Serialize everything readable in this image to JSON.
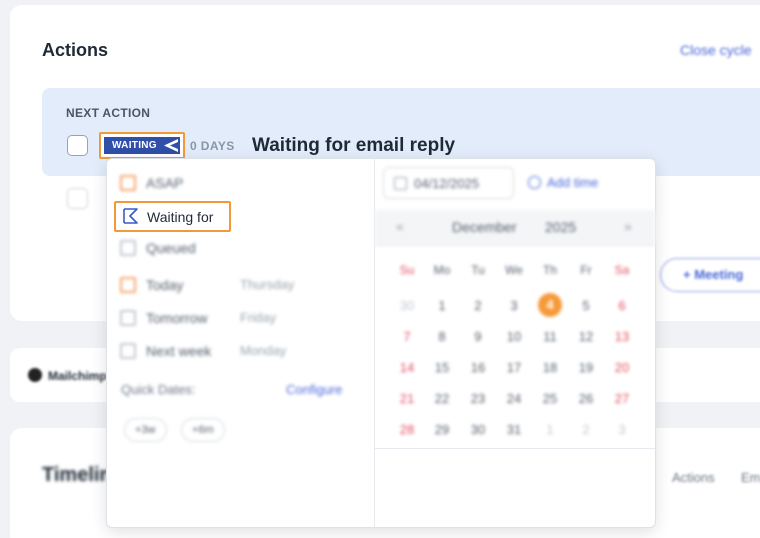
{
  "actions_section": {
    "title": "Actions",
    "close_cycle_label": "Close cycle",
    "next_action_label": "NEXT ACTION",
    "status_tag": "WAITING",
    "days_label": "0 DAYS",
    "action_title": "Waiting for email reply",
    "meeting_button_label": "+ Meeting"
  },
  "integration": {
    "name": "Mailchimp"
  },
  "timeline_section": {
    "title": "Timeline",
    "tabs": [
      "Actions",
      "Em"
    ]
  },
  "popup": {
    "options": [
      {
        "label": "ASAP",
        "sub": ""
      },
      {
        "label": "Waiting for",
        "sub": ""
      },
      {
        "label": "Queued",
        "sub": ""
      },
      {
        "label": "Today",
        "sub": "Thursday"
      },
      {
        "label": "Tomorrow",
        "sub": "Friday"
      },
      {
        "label": "Next week",
        "sub": "Monday"
      }
    ],
    "quick_dates_label": "Quick Dates:",
    "configure_label": "Configure",
    "chips": [
      "+3w",
      "+6m"
    ],
    "date_value": "04/12/2025",
    "add_time_label": "Add time",
    "calendar": {
      "month": "December",
      "year": "2025",
      "prev": "«",
      "next": "»",
      "weekdays": [
        "Su",
        "Mo",
        "Tu",
        "We",
        "Th",
        "Fr",
        "Sa"
      ],
      "weeks": [
        [
          "30",
          "1",
          "2",
          "3",
          "4",
          "5",
          "6"
        ],
        [
          "7",
          "8",
          "9",
          "10",
          "11",
          "12",
          "13"
        ],
        [
          "14",
          "15",
          "16",
          "17",
          "18",
          "19",
          "20"
        ],
        [
          "21",
          "22",
          "23",
          "24",
          "25",
          "26",
          "27"
        ],
        [
          "28",
          "29",
          "30",
          "31",
          "1",
          "2",
          "3"
        ]
      ]
    }
  }
}
